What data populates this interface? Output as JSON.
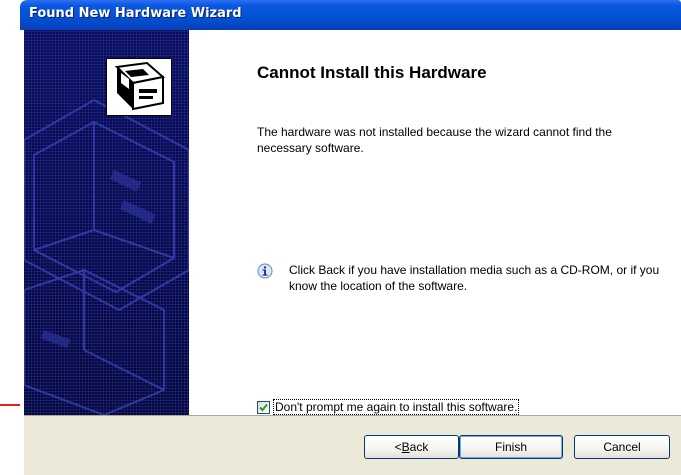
{
  "window": {
    "title": "Found New Hardware Wizard"
  },
  "main": {
    "heading": "Cannot Install this Hardware",
    "description": "The hardware was not installed because the wizard cannot find the necessary software.",
    "info_text": "Click Back if you have installation media such as a CD-ROM, or if you know the location of the software.",
    "checkbox": {
      "label": "Don't prompt me again to install this software.",
      "checked": true
    }
  },
  "buttons": {
    "back": {
      "prefix": "< ",
      "mnemonic": "B",
      "rest": "ack"
    },
    "finish": "Finish",
    "cancel": "Cancel"
  },
  "colors": {
    "titlebar": "#0553d6",
    "wizard_panel": "#06094d",
    "button_bar": "#ece9d8",
    "annotation_arrow": "#e02020"
  }
}
